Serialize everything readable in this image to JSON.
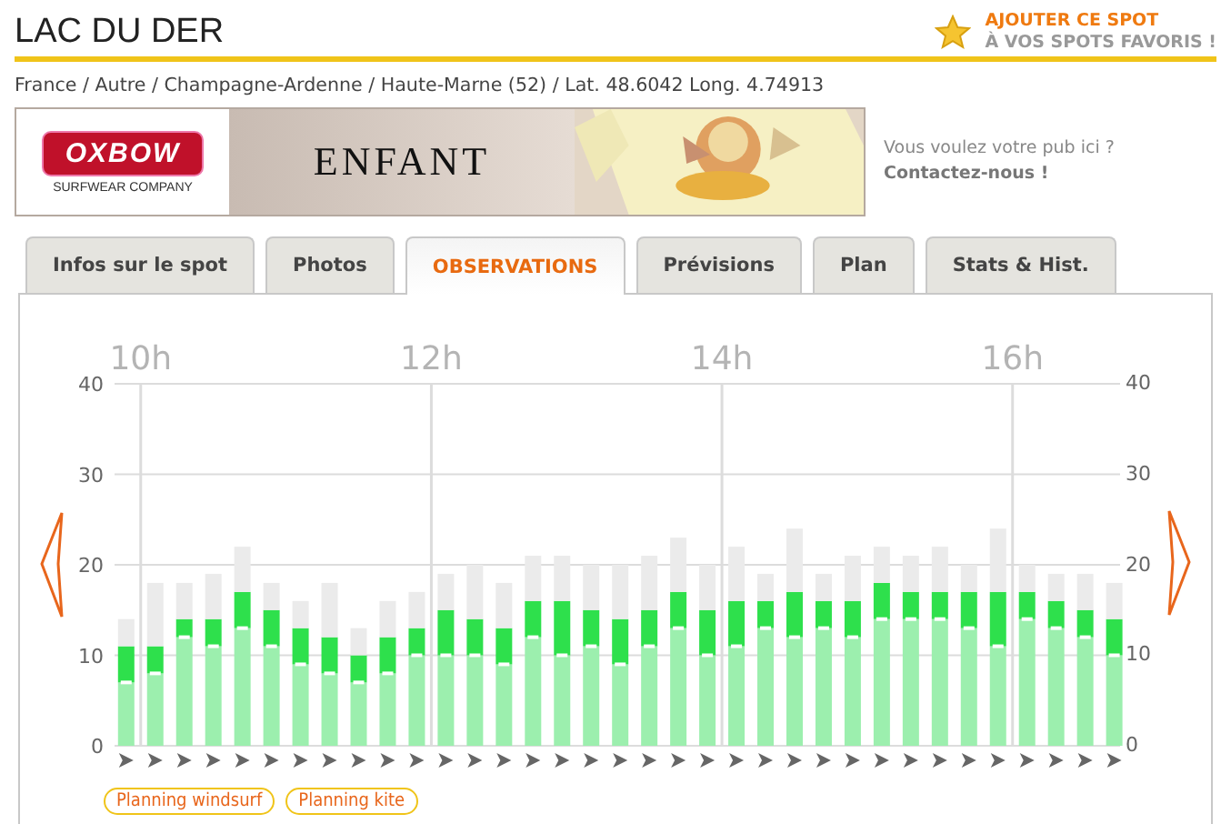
{
  "header": {
    "title": "LAC DU DER",
    "favorite_line1": "AJOUTER CE SPOT",
    "favorite_line2": "À VOS SPOTS FAVORIS !"
  },
  "breadcrumb": "France / Autre / Champagne-Ardenne / Haute-Marne (52) / Lat. 48.6042 Long. 4.74913",
  "banner": {
    "brand": "OXBOW",
    "tagline": "SURFWEAR COMPANY",
    "headline": "ENFANT"
  },
  "ad_prompt": {
    "text": "Vous voulez votre pub ici ?",
    "link": "Contactez-nous !"
  },
  "tabs": [
    {
      "label": "Infos sur le spot",
      "selected": false
    },
    {
      "label": "Photos",
      "selected": false
    },
    {
      "label": "OBSERVATIONS",
      "selected": true
    },
    {
      "label": "Prévisions",
      "selected": false
    },
    {
      "label": "Plan",
      "selected": false
    },
    {
      "label": "Stats & Hist.",
      "selected": false
    }
  ],
  "chart": {
    "chart_data": {
      "type": "bar",
      "stacked": true,
      "grid": true,
      "x": [
        9.9,
        10.1,
        10.3,
        10.5,
        10.7,
        10.9,
        11.1,
        11.3,
        11.5,
        11.7,
        11.9,
        12.1,
        12.3,
        12.5,
        12.7,
        12.9,
        13.1,
        13.3,
        13.5,
        13.7,
        13.9,
        14.1,
        14.3,
        14.5,
        14.7,
        14.9,
        15.1,
        15.3,
        15.5,
        15.7,
        15.9,
        16.1,
        16.3,
        16.5,
        16.7
      ],
      "series": [
        {
          "color": "#9cefae",
          "values": [
            7,
            8,
            12,
            11,
            13,
            11,
            9,
            8,
            7,
            8,
            10,
            10,
            10,
            9,
            12,
            10,
            11,
            9,
            11,
            13,
            10,
            11,
            13,
            12,
            13,
            12,
            14,
            14,
            14,
            13,
            11,
            14,
            13,
            12,
            10
          ]
        },
        {
          "color": "#2ee04c",
          "values": [
            4,
            3,
            2,
            3,
            4,
            4,
            4,
            4,
            3,
            4,
            3,
            5,
            4,
            4,
            4,
            6,
            4,
            5,
            4,
            4,
            5,
            5,
            3,
            5,
            3,
            4,
            4,
            3,
            3,
            4,
            6,
            3,
            3,
            3,
            4
          ]
        },
        {
          "color": "#ebebeb",
          "values": [
            3,
            7,
            4,
            5,
            5,
            3,
            3,
            6,
            3,
            4,
            4,
            4,
            6,
            5,
            5,
            5,
            5,
            6,
            6,
            6,
            5,
            6,
            3,
            7,
            3,
            5,
            4,
            4,
            5,
            3,
            7,
            3,
            3,
            4,
            4
          ]
        }
      ],
      "xlim": [
        9.82,
        16.74
      ],
      "ylim": [
        0,
        40
      ],
      "yticks": [
        0,
        10,
        20,
        30,
        40
      ],
      "xticks": [
        {
          "value": 10,
          "label": "10h"
        },
        {
          "value": 12,
          "label": "12h"
        },
        {
          "value": 14,
          "label": "14h"
        },
        {
          "value": 16,
          "label": "16h"
        }
      ]
    },
    "right_axis_labels": [
      "40",
      "30",
      "20",
      "10",
      "0"
    ]
  },
  "buttons": [
    "Planning windsurf",
    "Planning kite"
  ]
}
